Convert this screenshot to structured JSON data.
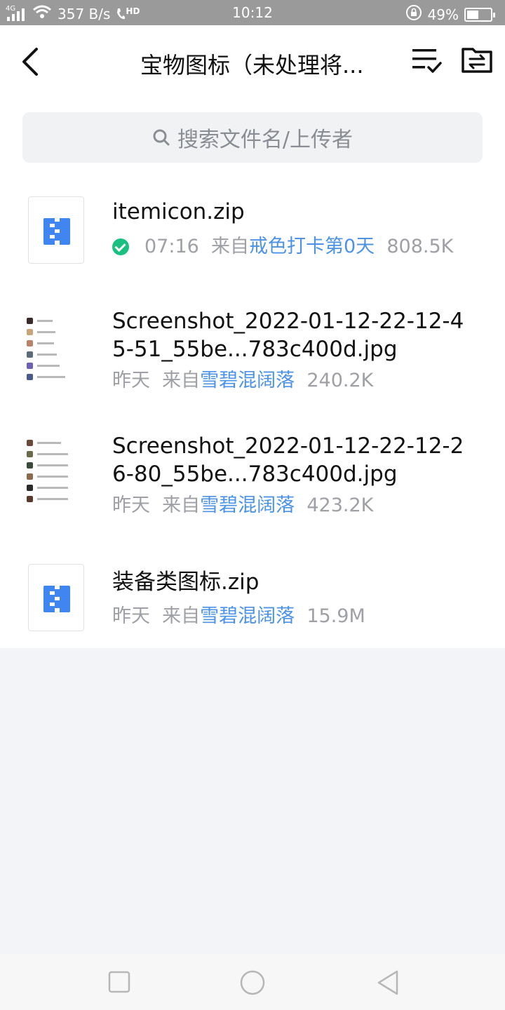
{
  "status_bar": {
    "network": "4G",
    "speed": "357 B/s",
    "hd": "HD",
    "time": "10:12",
    "battery_text": "49%",
    "battery_level": 0.49
  },
  "header": {
    "title": "宝物图标（未处理将..."
  },
  "search": {
    "placeholder": "搜索文件名/上传者"
  },
  "files": [
    {
      "name": "itemicon.zip",
      "time": "07:16",
      "from": "来自",
      "source": "戒色打卡第0天",
      "size": "808.5K"
    },
    {
      "name": "Screenshot_2022-01-12-22-12-45-51_55be...783c400d.jpg",
      "time": "昨天",
      "from": "来自",
      "source": "雪碧混阔落",
      "size": "240.2K"
    },
    {
      "name": "Screenshot_2022-01-12-22-12-26-80_55be...783c400d.jpg",
      "time": "昨天",
      "from": "来自",
      "source": "雪碧混阔落",
      "size": "423.2K"
    },
    {
      "name": "装备类图标.zip",
      "time": "昨天",
      "from": "来自",
      "source": "雪碧混阔落",
      "size": "15.9M"
    }
  ],
  "colors": {
    "accent": "#4c93e5",
    "zip_icon": "#3f86f0",
    "success": "#19c07f"
  }
}
